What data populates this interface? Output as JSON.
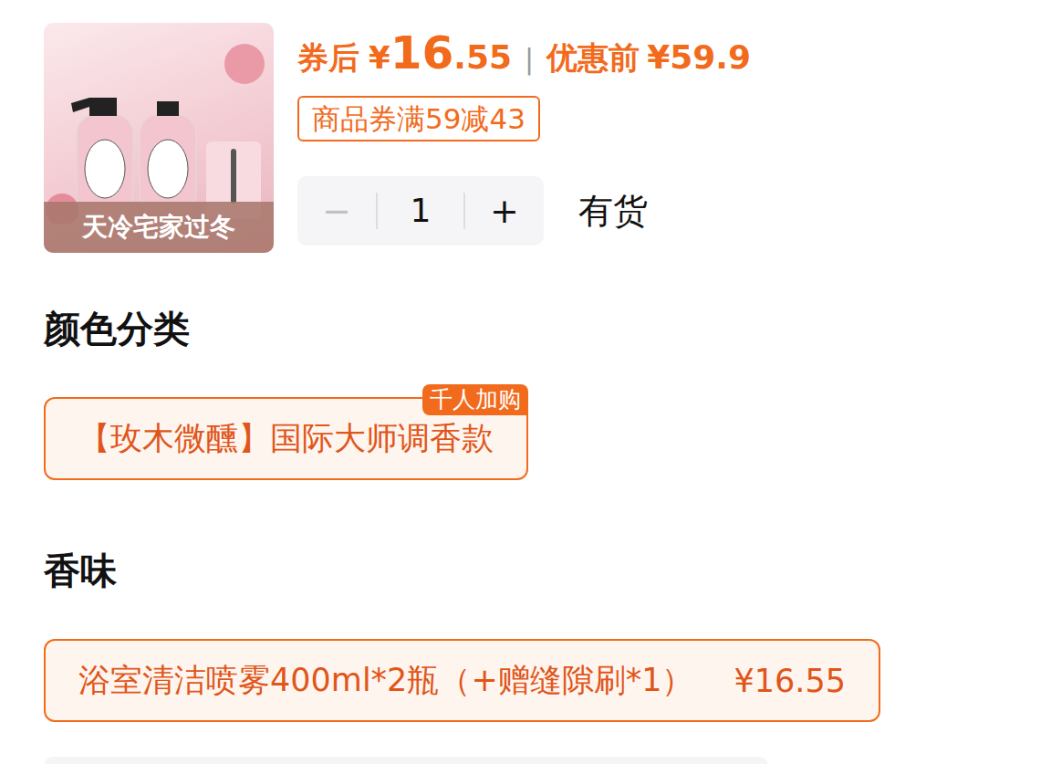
{
  "product": {
    "image_banner": "天冷宅家过冬"
  },
  "price": {
    "label": "券后",
    "currency": "¥",
    "integer": "16",
    "decimal": ".55",
    "divider": "|",
    "original_label": "优惠前",
    "original_price": "¥59.9"
  },
  "coupon": "商品券满59减43",
  "quantity": {
    "decrement": "−",
    "value": "1",
    "increment": "+",
    "decrement_disabled": true
  },
  "stock": "有货",
  "option_groups": [
    {
      "title": "颜色分类",
      "options": [
        {
          "label": "【玫木微醺】国际大师调香款",
          "badge": "千人加购",
          "selected": true
        }
      ]
    },
    {
      "title": "香味",
      "options": [
        {
          "label": "浴室清洁喷雾400ml*2瓶（+赠缝隙刷*1）",
          "price": "¥16.55",
          "selected": true
        }
      ]
    }
  ]
}
